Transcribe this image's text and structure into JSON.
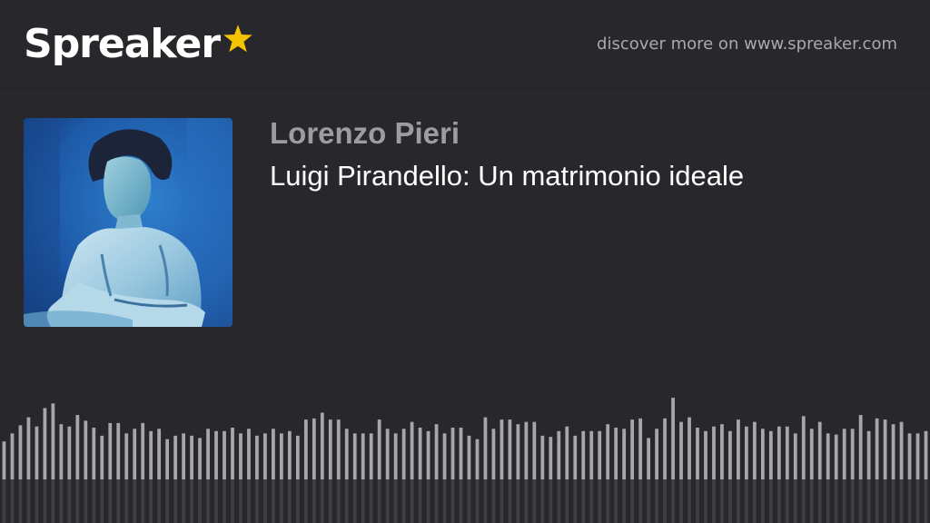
{
  "header": {
    "brand": "Spreaker",
    "tagline": "discover more on www.spreaker.com",
    "star_color": "#f5c400"
  },
  "episode": {
    "author": "Lorenzo Pieri",
    "title": "Luigi Pirandello: Un matrimonio ideale"
  },
  "cover_art": {
    "description_icon": "podcast-cover-image"
  },
  "waveform": {
    "bar_color": "#a7a7ab",
    "levels": [
      0.33,
      0.4,
      0.47,
      0.54,
      0.46,
      0.62,
      0.66,
      0.48,
      0.46,
      0.56,
      0.51,
      0.45,
      0.38,
      0.49,
      0.49,
      0.4,
      0.44,
      0.49,
      0.42,
      0.44,
      0.35,
      0.38,
      0.4,
      0.38,
      0.36,
      0.44,
      0.42,
      0.42,
      0.45,
      0.4,
      0.44,
      0.38,
      0.4,
      0.44,
      0.4,
      0.42,
      0.38,
      0.52,
      0.53,
      0.58,
      0.52,
      0.52,
      0.44,
      0.4,
      0.4,
      0.4,
      0.52,
      0.44,
      0.4,
      0.44,
      0.5,
      0.45,
      0.42,
      0.48,
      0.4,
      0.45,
      0.45,
      0.38,
      0.35,
      0.54,
      0.44,
      0.52,
      0.52,
      0.48,
      0.5,
      0.5,
      0.38,
      0.37,
      0.42,
      0.46,
      0.38,
      0.42,
      0.42,
      0.42,
      0.48,
      0.45,
      0.44,
      0.52,
      0.53,
      0.36,
      0.44,
      0.53,
      0.71,
      0.5,
      0.54,
      0.45,
      0.42,
      0.46,
      0.48,
      0.42,
      0.52,
      0.46,
      0.5,
      0.44,
      0.42,
      0.46,
      0.46,
      0.4,
      0.55,
      0.44,
      0.5,
      0.4,
      0.39,
      0.44,
      0.44,
      0.56,
      0.42,
      0.53,
      0.52,
      0.48,
      0.5,
      0.4,
      0.4,
      0.42
    ]
  }
}
